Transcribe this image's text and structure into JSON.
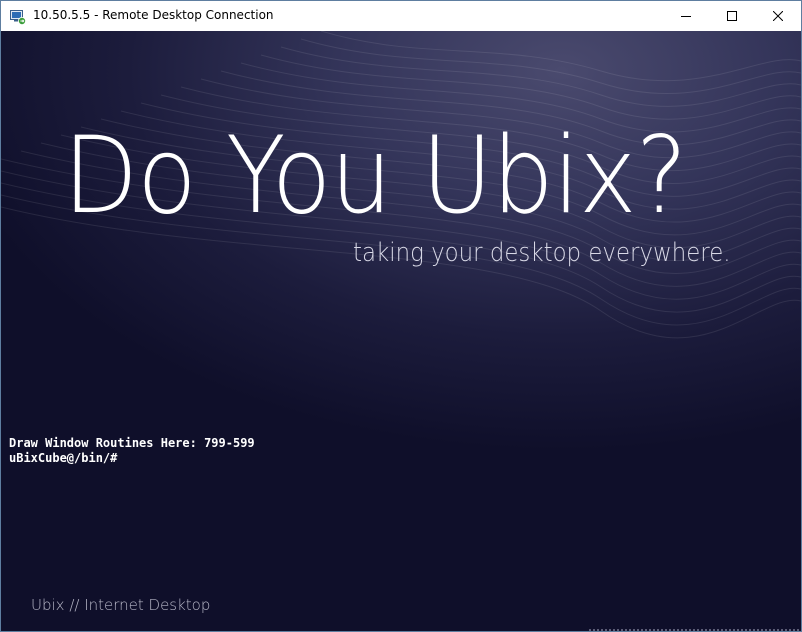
{
  "window": {
    "title": "10.50.5.5 - Remote Desktop Connection",
    "controls": {
      "minimize": "minimize-icon",
      "maximize": "maximize-icon",
      "close": "close-icon"
    }
  },
  "desktop": {
    "headline": "Do You Ubix?",
    "tagline": "taking your desktop everywhere.",
    "console_lines": [
      "Draw Window Routines Here: 799-599",
      "uBixCube@/bin/#"
    ],
    "footer": "Ubix // Internet Desktop"
  },
  "colors": {
    "desktop_dark": "#0f0f2a",
    "desktop_light": "#4a4a6e",
    "text": "#ffffff"
  }
}
